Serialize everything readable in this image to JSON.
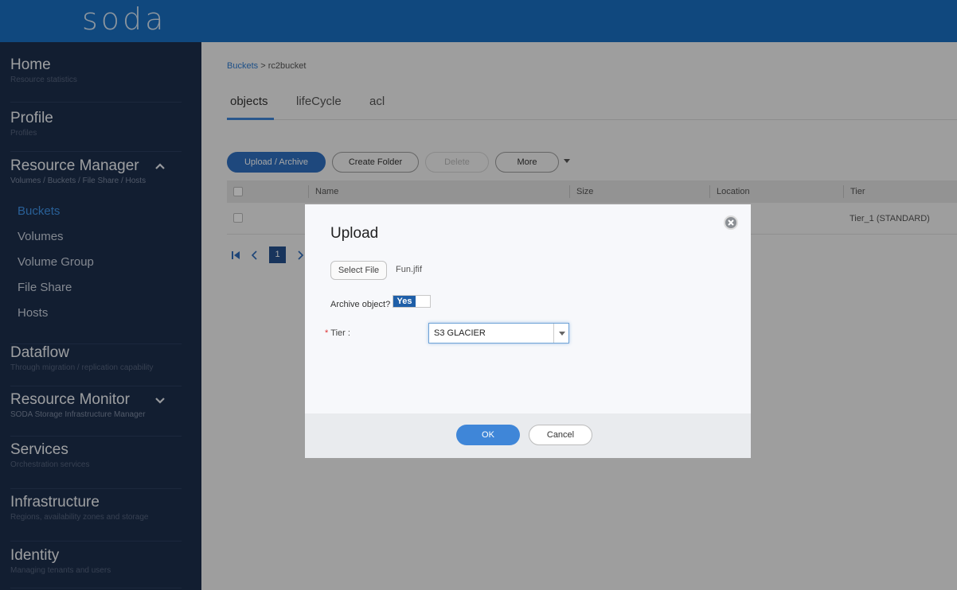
{
  "header": {
    "logo": "soda"
  },
  "sidebar": {
    "home": {
      "title": "Home",
      "sub": "Resource statistics"
    },
    "profile": {
      "title": "Profile",
      "sub": "Profiles"
    },
    "resource_manager": {
      "title": "Resource Manager",
      "sub": "Volumes / Buckets / File Share / Hosts",
      "items": [
        "Buckets",
        "Volumes",
        "Volume Group",
        "File Share",
        "Hosts"
      ]
    },
    "dataflow": {
      "title": "Dataflow",
      "sub": "Through migration / replication capability"
    },
    "resource_monitor": {
      "title": "Resource Monitor",
      "sub": "SODA Storage Infrastructure Manager"
    },
    "services": {
      "title": "Services",
      "sub": "Orchestration services"
    },
    "infrastructure": {
      "title": "Infrastructure",
      "sub": "Regions, availability zones and storage"
    },
    "identity": {
      "title": "Identity",
      "sub": "Managing tenants and users"
    }
  },
  "breadcrumb": {
    "parent": "Buckets",
    "separator": ">",
    "current": "rc2bucket"
  },
  "tabs": [
    "objects",
    "lifeCycle",
    "acl"
  ],
  "toolbar": {
    "upload": "Upload / Archive",
    "create_folder": "Create Folder",
    "delete": "Delete",
    "more": "More"
  },
  "table": {
    "columns": [
      "Name",
      "Size",
      "Location",
      "Tier"
    ],
    "rows": [
      {
        "tier": "Tier_1 (STANDARD)"
      }
    ]
  },
  "pagination": {
    "current_page": "1"
  },
  "modal": {
    "title": "Upload",
    "select_file": "Select File",
    "file_name": "Fun.jfif",
    "archive_label": "Archive object?",
    "toggle_value": "Yes",
    "tier_required": "*",
    "tier_label": "Tier :",
    "tier_value": "S3 GLACIER",
    "ok": "OK",
    "cancel": "Cancel"
  },
  "colors": {
    "topbar": "#1a6fc2",
    "sidebar": "#1c2e4c",
    "active_nav": "#3f94e8",
    "primary_button": "#2f6fc0"
  }
}
